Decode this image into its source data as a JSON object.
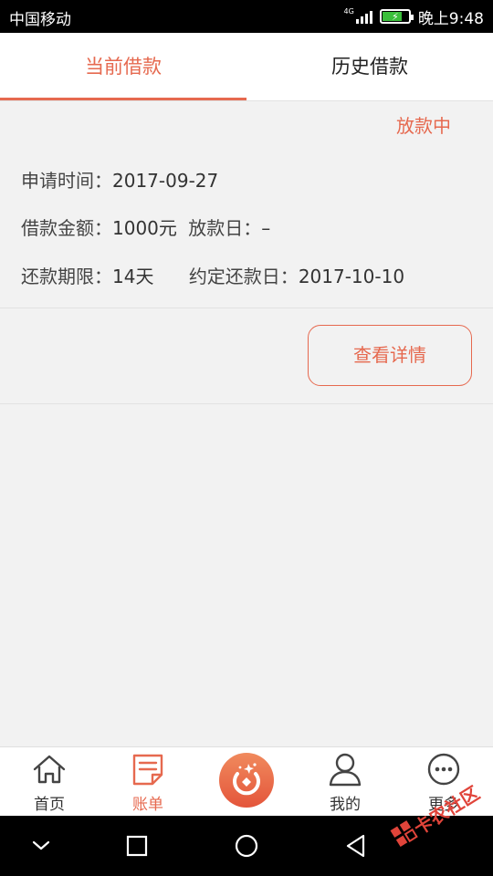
{
  "status_bar": {
    "carrier": "中国移动",
    "network": "4G",
    "time": "晚上9:48",
    "battery_color": "#3bbf3b"
  },
  "tabs": [
    {
      "label": "当前借款",
      "active": true
    },
    {
      "label": "历史借款",
      "active": false
    }
  ],
  "loan": {
    "status": "放款中",
    "apply_time_label": "申请时间：",
    "apply_time": "2017-09-27",
    "amount_label": "借款金额：",
    "amount": "1000元",
    "disburse_label": "放款日：",
    "disburse_date": "–",
    "term_label": "还款期限：",
    "term": "14天",
    "due_label": "约定还款日：",
    "due_date": "2017-10-10",
    "detail_button": "查看详情"
  },
  "bottom_nav": {
    "items": [
      {
        "label": "首页",
        "icon": "home-icon",
        "active": false
      },
      {
        "label": "账单",
        "icon": "bill-icon",
        "active": true
      },
      {
        "label": "",
        "icon": "loan-coin-icon",
        "active": false
      },
      {
        "label": "我的",
        "icon": "user-icon",
        "active": false
      },
      {
        "label": "更多",
        "icon": "more-icon",
        "active": false
      }
    ]
  },
  "system_nav": [
    "chevron-down-icon",
    "recents-square-icon",
    "home-circle-icon",
    "back-triangle-icon"
  ],
  "watermark": {
    "text": "卡农社区",
    "icon": "kanong-logo"
  },
  "colors": {
    "accent": "#e6694f",
    "background": "#f2f2f2"
  }
}
